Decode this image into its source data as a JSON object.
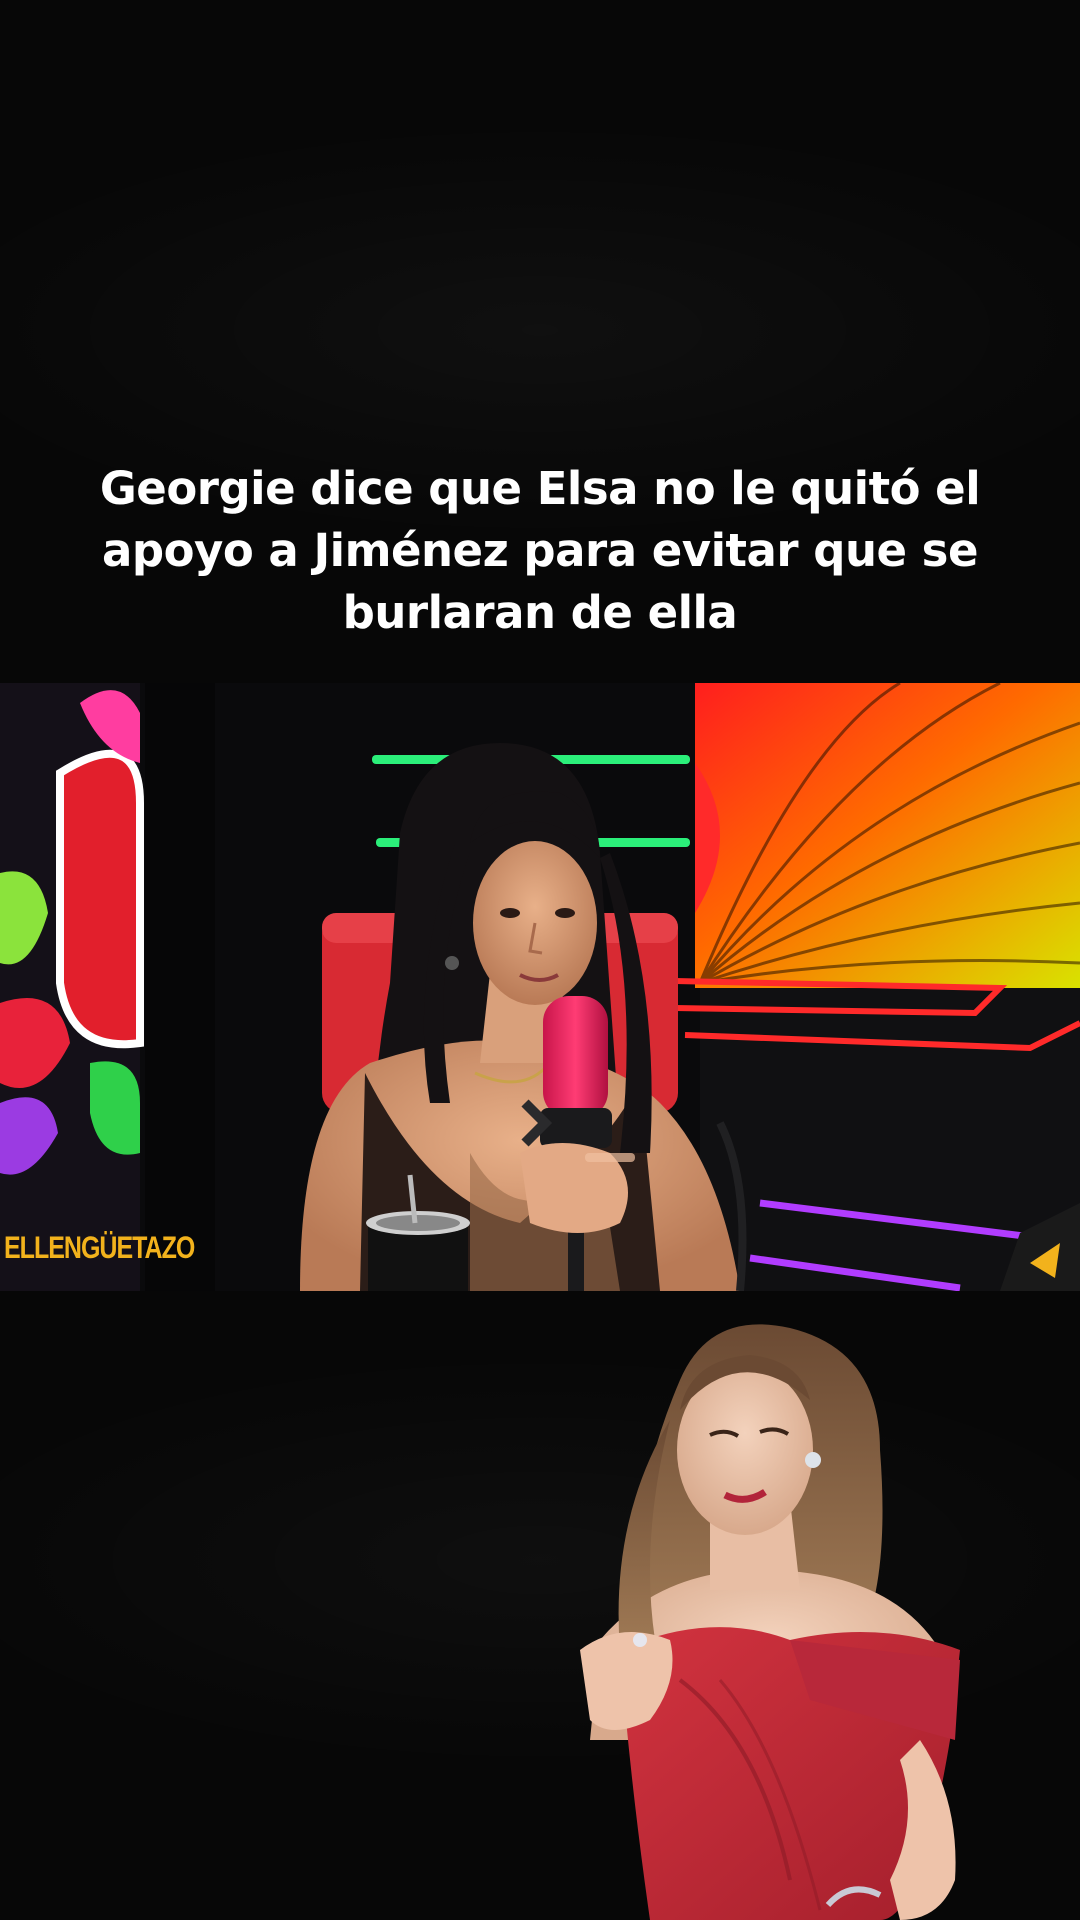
{
  "caption": {
    "lines": [
      "Georgie dice que Elsa no le quitó el",
      "apoyo a Jiménez para evitar que se",
      "burlaran de ella"
    ]
  },
  "video": {
    "watermark": "ELLENGÜETAZO"
  },
  "colors": {
    "background": "#070707",
    "caption_text": "#ffffff",
    "mic": "#e8245a",
    "chair": "#d82a33",
    "dress": "#c32a36",
    "neon_green": "#2bef7a",
    "neon_red": "#ff2a2a",
    "neon_purple": "#b13cff"
  }
}
